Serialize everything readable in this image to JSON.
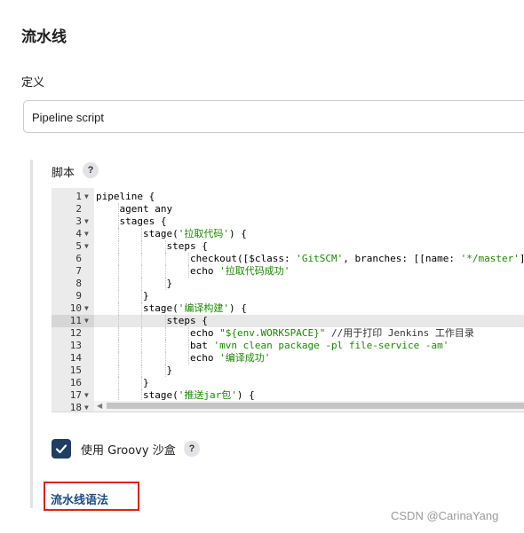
{
  "page": {
    "title": "流水线",
    "definition_label": "定义",
    "definition_value": "Pipeline script",
    "script_label": "脚本",
    "help_glyph": "?",
    "groovy_sandbox_label": "使用 Groovy 沙盒",
    "groovy_sandbox_checked": true,
    "pipeline_syntax_link": "流水线语法",
    "watermark": "CSDN @CarinaYang"
  },
  "editor": {
    "active_line": 11,
    "lines": [
      {
        "n": "1",
        "fold": true,
        "indent": 0,
        "parts": [
          [
            "pipeline {",
            ""
          ]
        ]
      },
      {
        "n": "2",
        "fold": false,
        "indent": 1,
        "parts": [
          [
            "agent any",
            ""
          ]
        ]
      },
      {
        "n": "3",
        "fold": true,
        "indent": 1,
        "parts": [
          [
            "stages {",
            ""
          ]
        ]
      },
      {
        "n": "4",
        "fold": true,
        "indent": 2,
        "parts": [
          [
            "stage(",
            ""
          ],
          [
            "'拉取代码'",
            "str"
          ],
          [
            ") {",
            ""
          ]
        ]
      },
      {
        "n": "5",
        "fold": true,
        "indent": 3,
        "parts": [
          [
            "steps {",
            ""
          ]
        ]
      },
      {
        "n": "6",
        "fold": false,
        "indent": 4,
        "parts": [
          [
            "checkout([$class: ",
            ""
          ],
          [
            "'GitSCM'",
            "str"
          ],
          [
            ", branches: [[name: ",
            ""
          ],
          [
            "'*/master'",
            "str"
          ],
          [
            "]], doGenerateSubmoduleConfigurations",
            ""
          ]
        ]
      },
      {
        "n": "7",
        "fold": false,
        "indent": 4,
        "parts": [
          [
            "echo ",
            ""
          ],
          [
            "'拉取代码成功'",
            "str"
          ]
        ]
      },
      {
        "n": "8",
        "fold": false,
        "indent": 3,
        "parts": [
          [
            "}",
            ""
          ]
        ]
      },
      {
        "n": "9",
        "fold": false,
        "indent": 2,
        "parts": [
          [
            "}",
            ""
          ]
        ]
      },
      {
        "n": "10",
        "fold": true,
        "indent": 2,
        "parts": [
          [
            "stage(",
            ""
          ],
          [
            "'编译构建'",
            "str"
          ],
          [
            ") {",
            ""
          ]
        ]
      },
      {
        "n": "11",
        "fold": true,
        "indent": 3,
        "parts": [
          [
            "steps {",
            ""
          ]
        ]
      },
      {
        "n": "12",
        "fold": false,
        "indent": 4,
        "parts": [
          [
            "echo ",
            ""
          ],
          [
            "\"${env.WORKSPACE}\"",
            "str"
          ],
          [
            " //用于打印 Jenkins 工作目录",
            "cmt"
          ]
        ]
      },
      {
        "n": "13",
        "fold": false,
        "indent": 4,
        "parts": [
          [
            "bat ",
            ""
          ],
          [
            "'mvn clean package -pl file-service -am'",
            "str"
          ]
        ]
      },
      {
        "n": "14",
        "fold": false,
        "indent": 4,
        "parts": [
          [
            "echo ",
            ""
          ],
          [
            "'编译成功'",
            "str"
          ]
        ]
      },
      {
        "n": "15",
        "fold": false,
        "indent": 3,
        "parts": [
          [
            "}",
            ""
          ]
        ]
      },
      {
        "n": "16",
        "fold": false,
        "indent": 2,
        "parts": [
          [
            "}",
            ""
          ]
        ]
      },
      {
        "n": "17",
        "fold": true,
        "indent": 2,
        "parts": [
          [
            "stage(",
            ""
          ],
          [
            "'推送jar包'",
            "str"
          ],
          [
            ") {",
            ""
          ]
        ]
      },
      {
        "n": "18",
        "fold": true,
        "indent": 3,
        "parts": [
          [
            "",
            ""
          ]
        ]
      }
    ]
  }
}
